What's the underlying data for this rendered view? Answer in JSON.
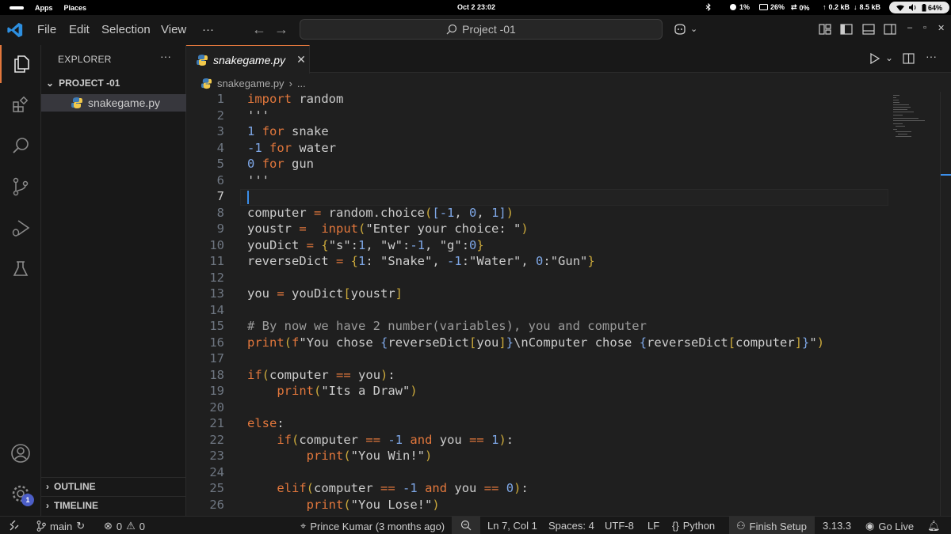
{
  "topbar": {
    "apps": "Apps",
    "places": "Places",
    "clock": "Oct 2  23:02",
    "cpu": "1%",
    "mem": "26%",
    "swap": "0%",
    "net_up": "0.2 kB",
    "net_down": "8.5 kB",
    "battery": "64%"
  },
  "titlebar": {
    "menu": [
      "File",
      "Edit",
      "Selection",
      "View"
    ],
    "more": "···",
    "search": "Project -01"
  },
  "explorer": {
    "title": "EXPLORER",
    "more": "···",
    "project": "PROJECT -01",
    "file": "snakegame.py",
    "outline": "OUTLINE",
    "timeline": "TIMELINE"
  },
  "activity": {
    "badge": "1"
  },
  "editor": {
    "tab_label": "snakegame.py",
    "breadcrumb_file": "snakegame.py",
    "breadcrumb_more": "...",
    "current_line": 7,
    "lines": [
      "import random",
      "'''",
      "1 for snake",
      "-1 for water",
      "0 for gun",
      "'''",
      "",
      "computer = random.choice([-1, 0, 1])",
      "youstr =  input(\"Enter your choice: \")",
      "youDict = {\"s\":1, \"w\":-1, \"g\":0}",
      "reverseDict = {1: \"Snake\", -1:\"Water\", 0:\"Gun\"}",
      "",
      "you = youDict[youstr]",
      "",
      "# By now we have 2 number(variables), you and computer",
      "print(f\"You chose {reverseDict[you]}\\nComputer chose {reverseDict[computer]}\")",
      "",
      "if(computer == you):",
      "    print(\"Its a Draw\")",
      "",
      "else:",
      "    if(computer == -1 and you == 1):",
      "        print(\"You Win!\")",
      "",
      "    elif(computer == -1 and you == 0):",
      "        print(\"You Lose!\")"
    ]
  },
  "statusbar": {
    "branch": "main",
    "errors": "0",
    "warnings": "0",
    "blame": "Prince Kumar (3 months ago)",
    "position": "Ln 7, Col 1",
    "spaces": "Spaces: 4",
    "encoding": "UTF-8",
    "eol": "LF",
    "language": "Python",
    "setup": "Finish Setup",
    "version": "3.13.3",
    "golive": "Go Live"
  },
  "colors": {
    "accent": "#e2773c",
    "keyword": "#e2773c",
    "number": "#7ea7e6",
    "comment": "#9b9b9b",
    "bracket": "#cba93b",
    "badge": "#4c5ec7"
  }
}
